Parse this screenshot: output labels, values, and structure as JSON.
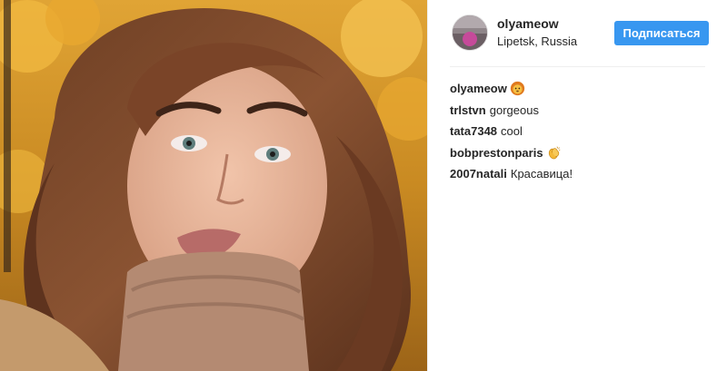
{
  "post": {
    "header": {
      "username": "olyameow",
      "location": "Lipetsk, Russia",
      "follow_label": "Подписаться"
    },
    "comments": [
      {
        "author": "olyameow",
        "text": "",
        "emoji": "lion-face-icon"
      },
      {
        "author": "trlstvn",
        "text": "gorgeous",
        "emoji": ""
      },
      {
        "author": "tata7348",
        "text": "cool",
        "emoji": ""
      },
      {
        "author": "bobprestonparis",
        "text": "",
        "emoji": "clapping-hands-icon"
      },
      {
        "author": "2007natali",
        "text": "Красавица!",
        "emoji": ""
      }
    ]
  },
  "colors": {
    "accent": "#3897f0",
    "text": "#262626",
    "divider": "#efefef",
    "photo_background": "#d89a2a"
  }
}
